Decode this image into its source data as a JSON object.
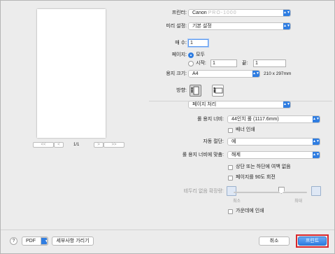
{
  "preview": {
    "page_count": "1/1",
    "nav_first": "<<",
    "nav_prev": "<",
    "nav_next": ">",
    "nav_last": ">>"
  },
  "printer": {
    "label": "프린터:",
    "value": "Canon",
    "value_obscured": "PRO-1000"
  },
  "presets": {
    "label": "미리 설정:",
    "value": "기본 설정"
  },
  "copies": {
    "label": "매 수:",
    "value": "1"
  },
  "pages": {
    "label": "페이지:",
    "all_label": "모두",
    "from_label": "시작:",
    "from_value": "1",
    "to_label": "끝:",
    "to_value": "1"
  },
  "paper_size": {
    "label": "용지 크기:",
    "value": "A4",
    "dimensions": "210 x 297mm"
  },
  "orientation": {
    "label": "방향:"
  },
  "section": {
    "value": "페이지 처리"
  },
  "roll_width": {
    "label": "롤 용지 너비:",
    "value": "44인치 롤 (1117.6mm)"
  },
  "banner_print": {
    "label": "배너 인쇄",
    "checked": false
  },
  "auto_cut": {
    "label": "자동 절단:",
    "value": "예"
  },
  "fit_roll": {
    "label": "롤 용지 너비에 맞춤:",
    "value": "해제"
  },
  "no_margin_top_bottom": {
    "label": "상단 또는 하단에 여백 없음",
    "checked": false
  },
  "rotate_90": {
    "label": "페이지를 90도 회전",
    "checked": false
  },
  "borderless_ext": {
    "label": "테두리 없음 확장량:",
    "min_label": "최소",
    "max_label": "최대",
    "level_fraction": 0.65
  },
  "center_print": {
    "label": "가운데에 인쇄",
    "checked": false
  },
  "footer": {
    "help": "?",
    "pdf": "PDF",
    "details": "세부사항 가리기",
    "cancel": "취소",
    "print": "프린트"
  },
  "colors": {
    "accent": "#2f7de1",
    "highlight": "#d8262b"
  }
}
